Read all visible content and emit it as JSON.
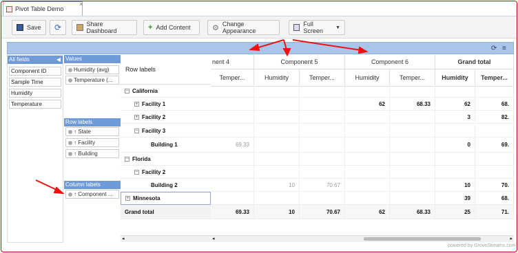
{
  "tab": {
    "title": "Pivot Table Demo",
    "close": "×"
  },
  "toolbar": {
    "save": "Save",
    "share_dashboard": "Share Dashboard",
    "add_content": "Add Content",
    "change_appearance": "Change Appearance",
    "full_screen": "Full Screen"
  },
  "fields": {
    "header": "All fields",
    "items": [
      "Component ID",
      "Sample Time",
      "Humidity",
      "Temperature"
    ]
  },
  "values_panel": {
    "header": "Values",
    "items": [
      "Humidity (avg)",
      "Temperature (..."
    ]
  },
  "row_labels_panel": {
    "header": "Row labels",
    "items": [
      "State",
      "Facility",
      "Building"
    ]
  },
  "column_labels_panel": {
    "header": "Column labels",
    "items": [
      "Component ..."
    ]
  },
  "grid": {
    "row_labels_header": "Row labels",
    "columns": [
      "nent 4",
      "Component 5",
      "Component 6",
      "Grand total"
    ],
    "subheaders": [
      "Temper...",
      "Humidity",
      "Temper...",
      "Humidity",
      "Temper...",
      "Humidity",
      "Temper..."
    ],
    "rows": [
      {
        "label": "California",
        "level": 0,
        "sign": "−",
        "cells": [
          "",
          "",
          "",
          "",
          "",
          "",
          ""
        ]
      },
      {
        "label": "Facility 1",
        "level": 1,
        "sign": "+",
        "cells": [
          "",
          "",
          "",
          "62",
          "68.33",
          "62",
          "68."
        ]
      },
      {
        "label": "Facility 2",
        "level": 1,
        "sign": "+",
        "cells": [
          "",
          "",
          "",
          "",
          "",
          "3",
          "82."
        ]
      },
      {
        "label": "Facility 3",
        "level": 1,
        "sign": "−",
        "cells": [
          "",
          "",
          "",
          "",
          "",
          "",
          ""
        ]
      },
      {
        "label": "Building 1",
        "level": 2,
        "sign": "",
        "cells": [
          "69.33",
          "",
          "",
          "",
          "",
          "0",
          "69."
        ]
      },
      {
        "label": "Florida",
        "level": 0,
        "sign": "−",
        "cells": [
          "",
          "",
          "",
          "",
          "",
          "",
          ""
        ]
      },
      {
        "label": "Facility 2",
        "level": 1,
        "sign": "−",
        "cells": [
          "",
          "",
          "",
          "",
          "",
          "",
          ""
        ]
      },
      {
        "label": "Building 2",
        "level": 2,
        "sign": "",
        "cells": [
          "",
          "10",
          "70.67",
          "",
          "",
          "10",
          "70."
        ]
      },
      {
        "label": "Minnesota",
        "level": 0,
        "sign": "+",
        "cells": [
          "",
          "",
          "",
          "",
          "",
          "39",
          "68."
        ]
      },
      {
        "label": "Grand total",
        "level": 0,
        "sign": "",
        "cells": [
          "69.33",
          "10",
          "70.67",
          "62",
          "68.33",
          "25",
          "71."
        ]
      }
    ]
  },
  "footer": "powered by GroveStreams.com"
}
